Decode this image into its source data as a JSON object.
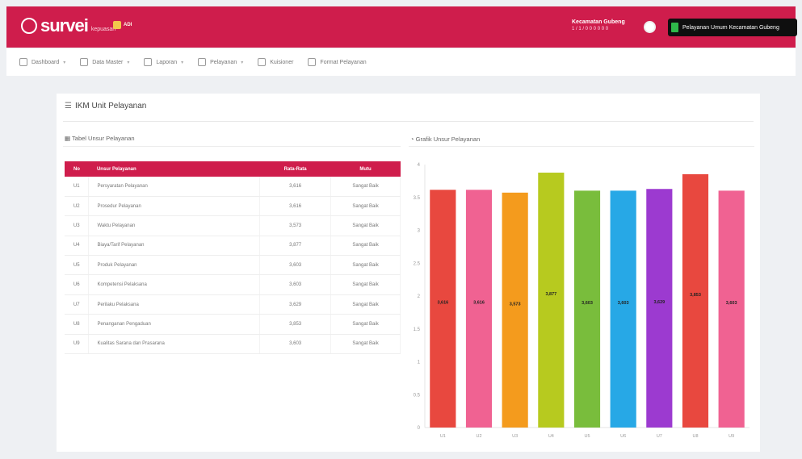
{
  "header": {
    "app_name": "survei",
    "app_sub": "kepuasan",
    "badge": "ADI",
    "user_name": "Kecamatan Gubeng",
    "user_sub": "1 / 1 / 0 0 0 0 0 0",
    "unit_button": "Pelayanan Umum Kecamatan Gubeng"
  },
  "menu": [
    {
      "icon": "dashboard-icon",
      "label": "Dashboard",
      "caret": true
    },
    {
      "icon": "database-icon",
      "label": "Data Master",
      "caret": true
    },
    {
      "icon": "document-icon",
      "label": "Laporan",
      "caret": true
    },
    {
      "icon": "clipboard-icon",
      "label": "Pelayanan",
      "caret": true
    },
    {
      "icon": "download-icon",
      "label": "Kuisioner",
      "caret": false
    },
    {
      "icon": "bell-icon",
      "label": "Format Pelayanan",
      "caret": false
    }
  ],
  "card": {
    "title": "IKM Unit Pelayanan",
    "left_title": "Tabel Unsur Pelayanan",
    "right_title": "Grafik Unsur Pelayanan"
  },
  "table": {
    "headers": [
      "No",
      "Unsur Pelayanan",
      "Rata-Rata",
      "Mutu"
    ],
    "rows": [
      [
        "U1",
        "Persyaratan Pelayanan",
        "3,616",
        "Sangat Baik"
      ],
      [
        "U2",
        "Prosedur Pelayanan",
        "3,616",
        "Sangat Baik"
      ],
      [
        "U3",
        "Waktu Pelayanan",
        "3,573",
        "Sangat Baik"
      ],
      [
        "U4",
        "Biaya/Tarif Pelayanan",
        "3,877",
        "Sangat Baik"
      ],
      [
        "U5",
        "Produk Pelayanan",
        "3,603",
        "Sangat Baik"
      ],
      [
        "U6",
        "Kompetensi Pelaksana",
        "3,603",
        "Sangat Baik"
      ],
      [
        "U7",
        "Perilaku Pelaksana",
        "3,629",
        "Sangat Baik"
      ],
      [
        "U8",
        "Penanganan Pengaduan",
        "3,853",
        "Sangat Baik"
      ],
      [
        "U9",
        "Kualitas Sarana dan Prasarana",
        "3,603",
        "Sangat Baik"
      ]
    ]
  },
  "chart_data": {
    "type": "bar",
    "categories": [
      "U1",
      "U2",
      "U3",
      "U4",
      "U5",
      "U6",
      "U7",
      "U8",
      "U9"
    ],
    "values": [
      3.616,
      3.616,
      3.573,
      3.877,
      3.603,
      3.603,
      3.629,
      3.853,
      3.603
    ],
    "labels": [
      "3,616",
      "3,616",
      "3,573",
      "3,877",
      "3,603",
      "3,603",
      "3,629",
      "3,853",
      "3,603"
    ],
    "colors": [
      "#e8483f",
      "#f06292",
      "#f49b1d",
      "#b7ca1f",
      "#79bd3c",
      "#27a8e6",
      "#9c3ad0",
      "#e8483f",
      "#f06292"
    ],
    "yticks": [
      "0",
      "0.5",
      "1",
      "1.5",
      "2",
      "2.5",
      "3",
      "3.5",
      "4"
    ],
    "ylim": [
      0,
      4
    ],
    "grid": false
  }
}
